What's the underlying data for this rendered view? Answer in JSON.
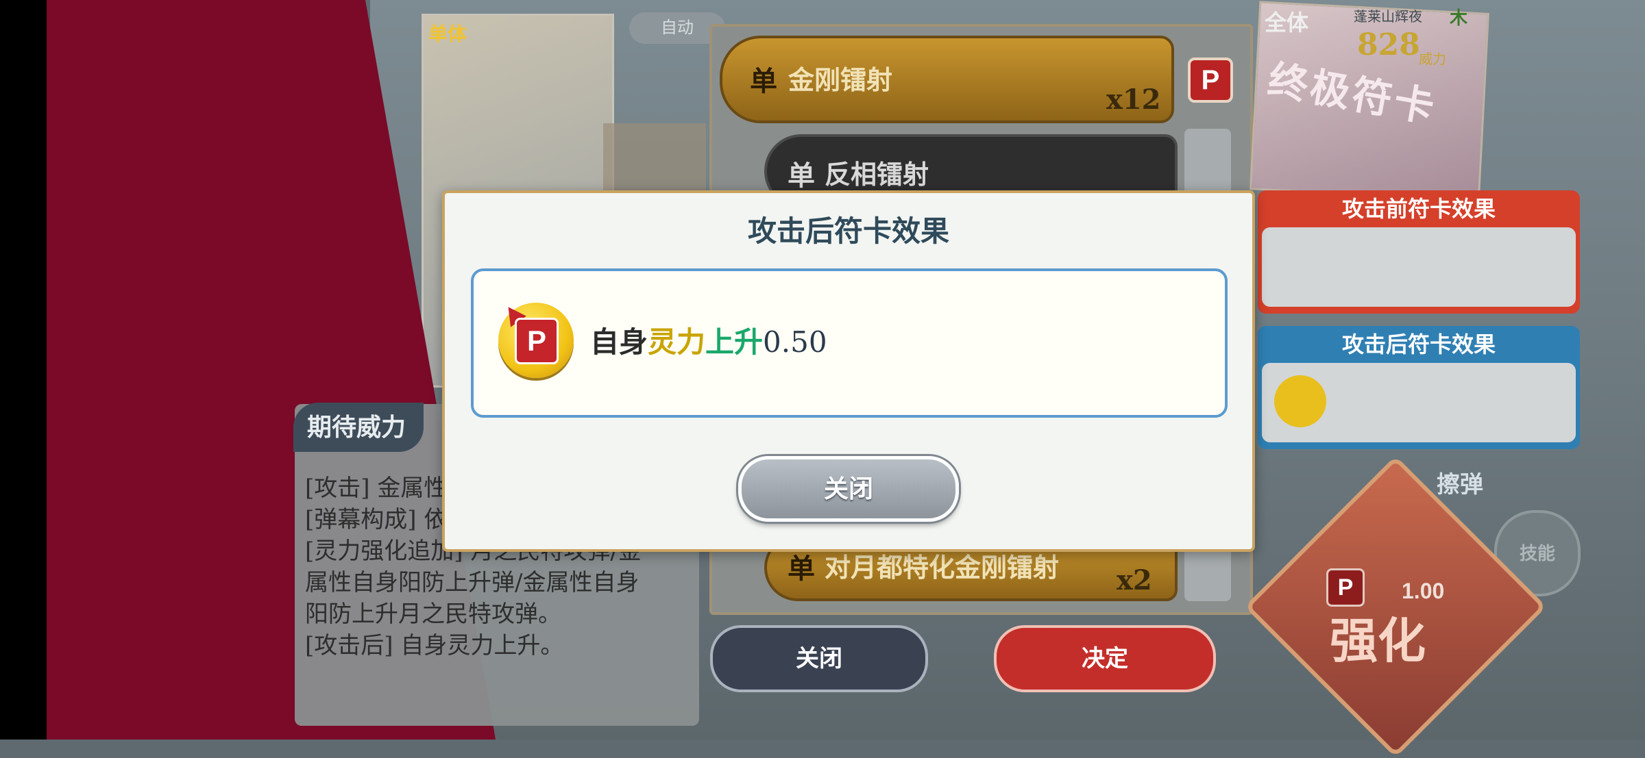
{
  "background": {
    "card_stack_tag": "单体",
    "top_button": "自动",
    "spell_list": [
      {
        "tag": "单",
        "name": "金刚镭射",
        "multiplier": "x12"
      },
      {
        "tag": "单",
        "name": "反相镭射",
        "multiplier": ""
      },
      {
        "tag": "单",
        "name": "对月都特化金刚镭射",
        "multiplier": "x2"
      }
    ],
    "p_badge": "P",
    "close_button": "关闭",
    "confirm_button": "决定",
    "expect_panel": {
      "title": "期待威力",
      "lines": [
        "[攻击] 金属性",
        "[弹幕构成] 依",
        "[灵力强化追加] 月之民特攻弹/金",
        "属性自身阳防上升弹/金属性自身",
        "阳防上升月之民特攻弹。",
        "[攻击后] 自身灵力上升。"
      ]
    },
    "ultimate_card": {
      "scope": "全体",
      "power": "828",
      "power_unit": "威力",
      "name": "终极符卡",
      "owner": "蓬莱山辉夜",
      "element": "木"
    },
    "pre_effect_title": "攻击前符卡效果",
    "post_effect_title": "攻击后符卡效果",
    "graze_label": "擦弹",
    "skill_label": "技能",
    "enhance_label": "强化",
    "enhance_value": "1.00"
  },
  "modal": {
    "title": "攻击后符卡效果",
    "effect": {
      "icon_letter": "P",
      "prefix": "自身",
      "part_yellow": "灵力",
      "part_green": "上升",
      "value": "0.50"
    },
    "close_label": "关闭"
  },
  "colors": {
    "crimson": "#7a0a28",
    "modal_border": "#c9a35f",
    "inner_border": "#5c9bd0",
    "yellow_text": "#c9a400",
    "green_text": "#1aa86b"
  }
}
